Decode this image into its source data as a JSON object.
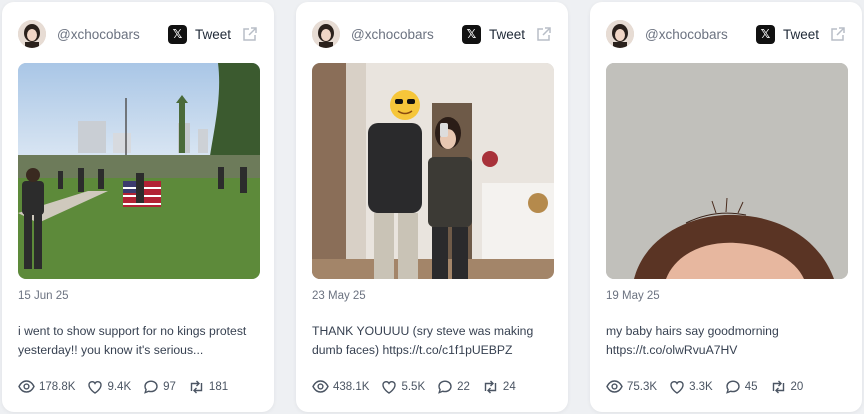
{
  "cards": [
    {
      "handle": "@xchocobars",
      "tweet_label": "Tweet",
      "date": "15 Jun 25",
      "text": "i went to show support for no kings protest yesterday!! you know it's serious...",
      "stats": {
        "views": "178.8K",
        "likes": "9.4K",
        "replies": "97",
        "retweets": "181"
      }
    },
    {
      "handle": "@xchocobars",
      "tweet_label": "Tweet",
      "date": "23 May 25",
      "text": "THANK YOUUUU (sry steve was making dumb faces) https://t.co/c1f1pUEBPZ",
      "stats": {
        "views": "438.1K",
        "likes": "5.5K",
        "replies": "22",
        "retweets": "24"
      }
    },
    {
      "handle": "@xchocobars",
      "tweet_label": "Tweet",
      "date": "19 May 25",
      "text": "my baby hairs say goodmorning https://t.co/olwRvuA7HV",
      "stats": {
        "views": "75.3K",
        "likes": "3.3K",
        "replies": "45",
        "retweets": "20"
      }
    }
  ],
  "icons": {
    "x_logo": "x-logo-icon",
    "external": "external-link-icon",
    "views": "eye-icon",
    "likes": "heart-icon",
    "replies": "comment-icon",
    "retweets": "retweet-icon"
  },
  "colors": {
    "background": "#eef0f3",
    "card": "#ffffff",
    "muted_text": "#6b7280",
    "body_text": "#374151"
  }
}
